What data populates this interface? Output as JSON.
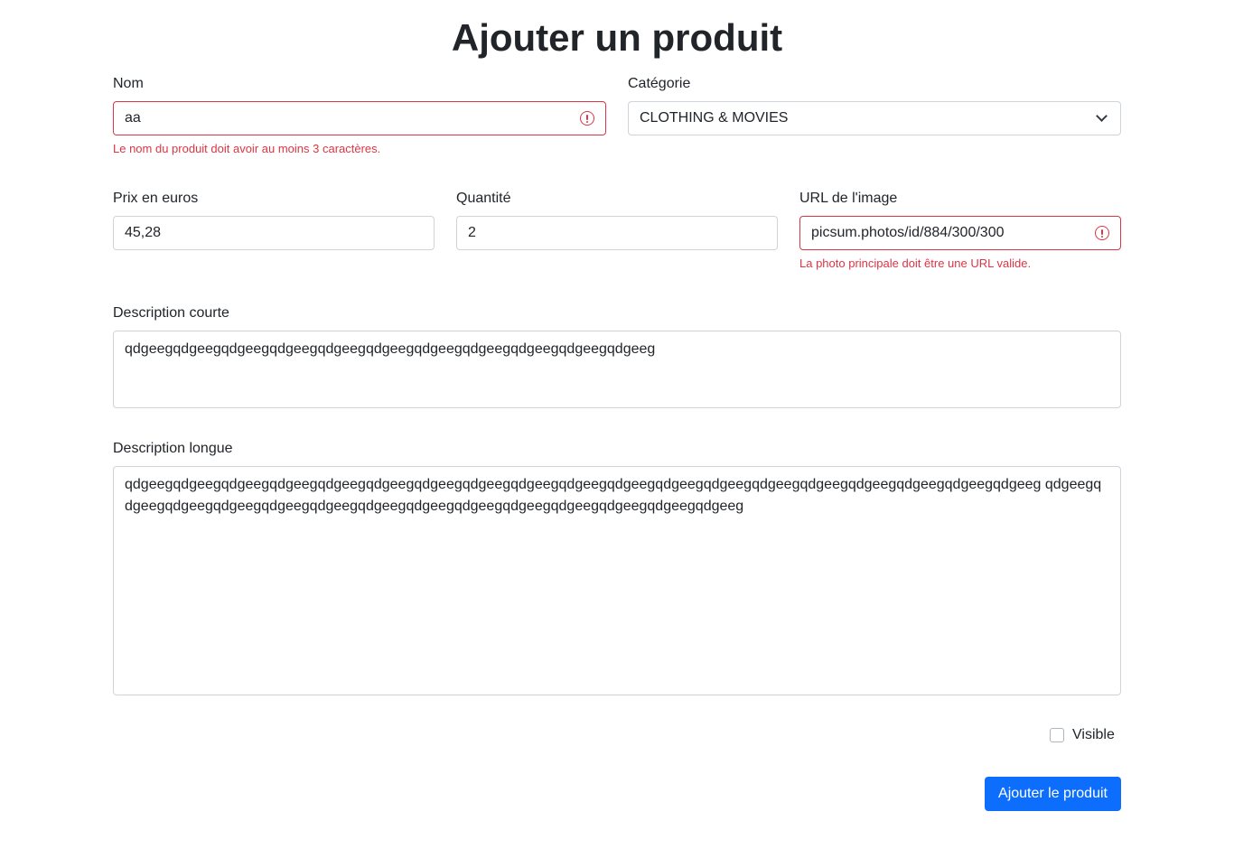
{
  "page": {
    "title": "Ajouter un produit"
  },
  "form": {
    "name": {
      "label": "Nom",
      "value": "aa",
      "error": "Le nom du produit doit avoir au moins 3 caractères."
    },
    "category": {
      "label": "Catégorie",
      "selected": "CLOTHING & MOVIES"
    },
    "price": {
      "label": "Prix en euros",
      "value": "45,28"
    },
    "quantity": {
      "label": "Quantité",
      "value": "2"
    },
    "image_url": {
      "label": "URL de l'image",
      "value": "picsum.photos/id/884/300/300",
      "error": "La photo principale doit être une URL valide."
    },
    "short_description": {
      "label": "Description courte",
      "value": "qdgeegqdgeegqdgeegqdgeegqdgeegqdgeegqdgeegqdgeegqdgeegqdgeegqdgeeg"
    },
    "long_description": {
      "label": "Description longue",
      "value": "qdgeegqdgeegqdgeegqdgeegqdgeegqdgeegqdgeegqdgeegqdgeegqdgeegqdgeegqdgeegqdgeegqdgeegqdgeegqdgeegqdgeegqdgeegqdgeeg qdgeegqdgeegqdgeegqdgeegqdgeegqdgeegqdgeegqdgeegqdgeegqdgeegqdgeegqdgeegqdgeegqdgeeg"
    },
    "visible": {
      "label": "Visible",
      "checked": false
    },
    "submit_label": "Ajouter le produit"
  },
  "colors": {
    "invalid": "#dc3545",
    "primary": "#0d6efd",
    "border": "#ced4da"
  }
}
